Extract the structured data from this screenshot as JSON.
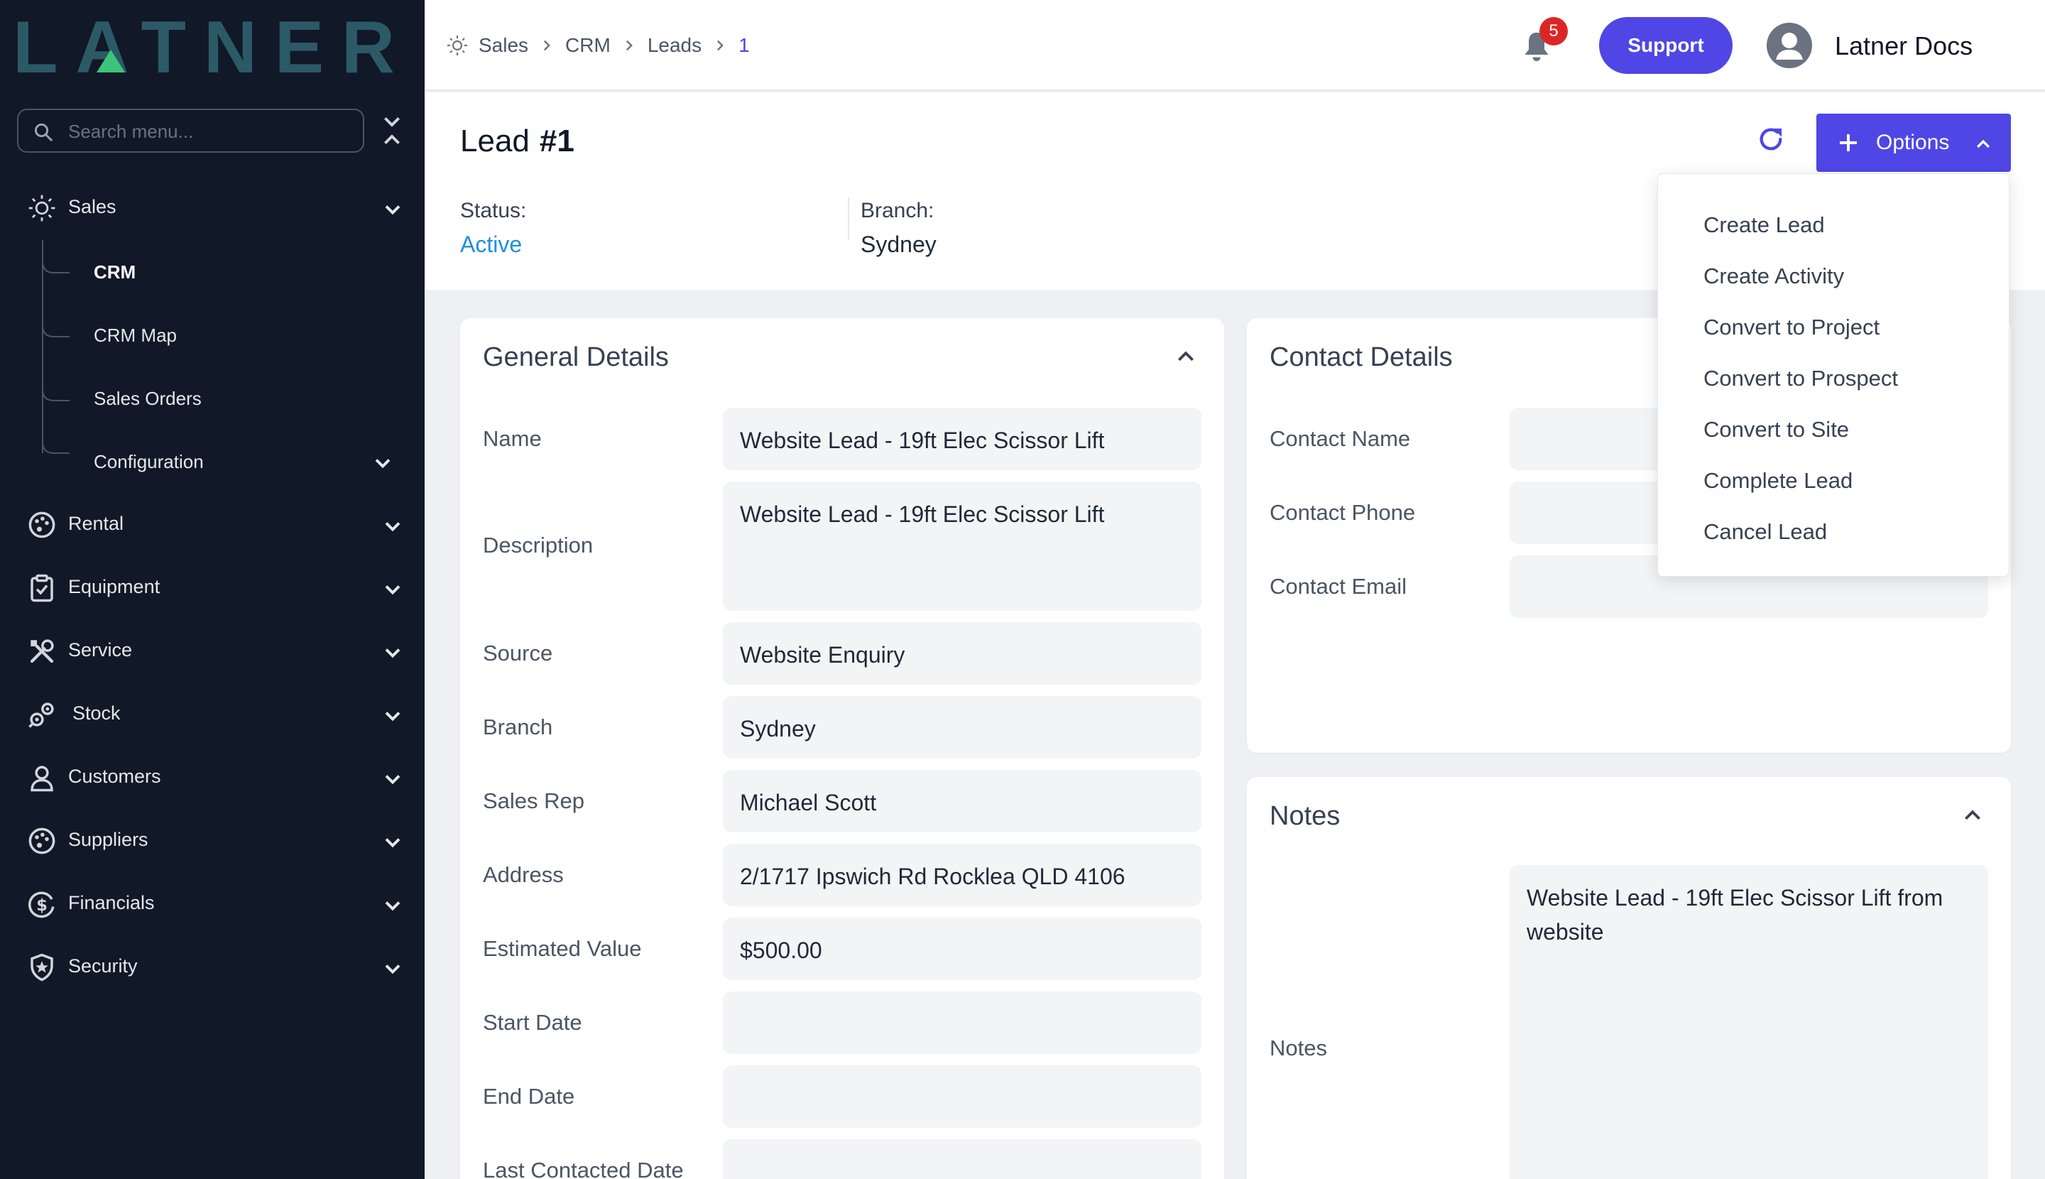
{
  "brand": {
    "logo_text": "LATNER",
    "accent": "#4f46e5",
    "sidebar_bg": "#111827",
    "logo_color": "#2b5a66",
    "logo_triangle": "#3cc47c"
  },
  "sidebar": {
    "search_placeholder": "Search menu...",
    "items": [
      {
        "label": "Sales",
        "icon": "sales-sun-icon"
      },
      {
        "label": "Rental",
        "icon": "rental-palette-icon"
      },
      {
        "label": "Equipment",
        "icon": "clipboard-check-icon"
      },
      {
        "label": "Service",
        "icon": "tools-icon"
      },
      {
        "label": "Stock",
        "icon": "stock-gears-icon"
      },
      {
        "label": "Customers",
        "icon": "user-icon"
      },
      {
        "label": "Suppliers",
        "icon": "palette-icon"
      },
      {
        "label": "Financials",
        "icon": "dollar-circle-icon"
      },
      {
        "label": "Security",
        "icon": "shield-star-icon"
      }
    ],
    "sales_sub": [
      {
        "label": "CRM"
      },
      {
        "label": "CRM Map"
      },
      {
        "label": "Sales Orders"
      },
      {
        "label": "Configuration"
      }
    ]
  },
  "topbar": {
    "breadcrumb": [
      "Sales",
      "CRM",
      "Leads",
      "1"
    ],
    "notification_count": "5",
    "support_label": "Support",
    "user_name": "Latner Docs"
  },
  "header": {
    "title_prefix": "Lead",
    "title_number": "#1",
    "status_label": "Status:",
    "status_value": "Active",
    "status_color": "#1d8fe0",
    "branch_label": "Branch:",
    "branch_value": "Sydney",
    "options_label": "Options"
  },
  "options_menu": [
    "Create Lead",
    "Create Activity",
    "Convert to Project",
    "Convert to Prospect",
    "Convert to Site",
    "Complete Lead",
    "Cancel Lead"
  ],
  "general": {
    "title": "General Details",
    "fields": [
      {
        "label": "Name",
        "value": "Website Lead - 19ft Elec Scissor Lift"
      },
      {
        "label": "Description",
        "value": "Website Lead - 19ft Elec Scissor Lift"
      },
      {
        "label": "Source",
        "value": "Website Enquiry"
      },
      {
        "label": "Branch",
        "value": "Sydney"
      },
      {
        "label": "Sales Rep",
        "value": "Michael Scott"
      },
      {
        "label": "Address",
        "value": "2/1717 Ipswich Rd Rocklea QLD 4106"
      },
      {
        "label": "Estimated Value",
        "value": "$500.00"
      },
      {
        "label": "Start Date",
        "value": ""
      },
      {
        "label": "End Date",
        "value": ""
      },
      {
        "label": "Last Contacted Date",
        "value": ""
      }
    ]
  },
  "contact": {
    "title": "Contact Details",
    "fields": [
      {
        "label": "Contact Name",
        "value": ""
      },
      {
        "label": "Contact Phone",
        "value": ""
      },
      {
        "label": "Contact Email",
        "value": ""
      }
    ]
  },
  "notes": {
    "title": "Notes",
    "label": "Notes",
    "value": "Website Lead - 19ft Elec Scissor Lift from website"
  }
}
